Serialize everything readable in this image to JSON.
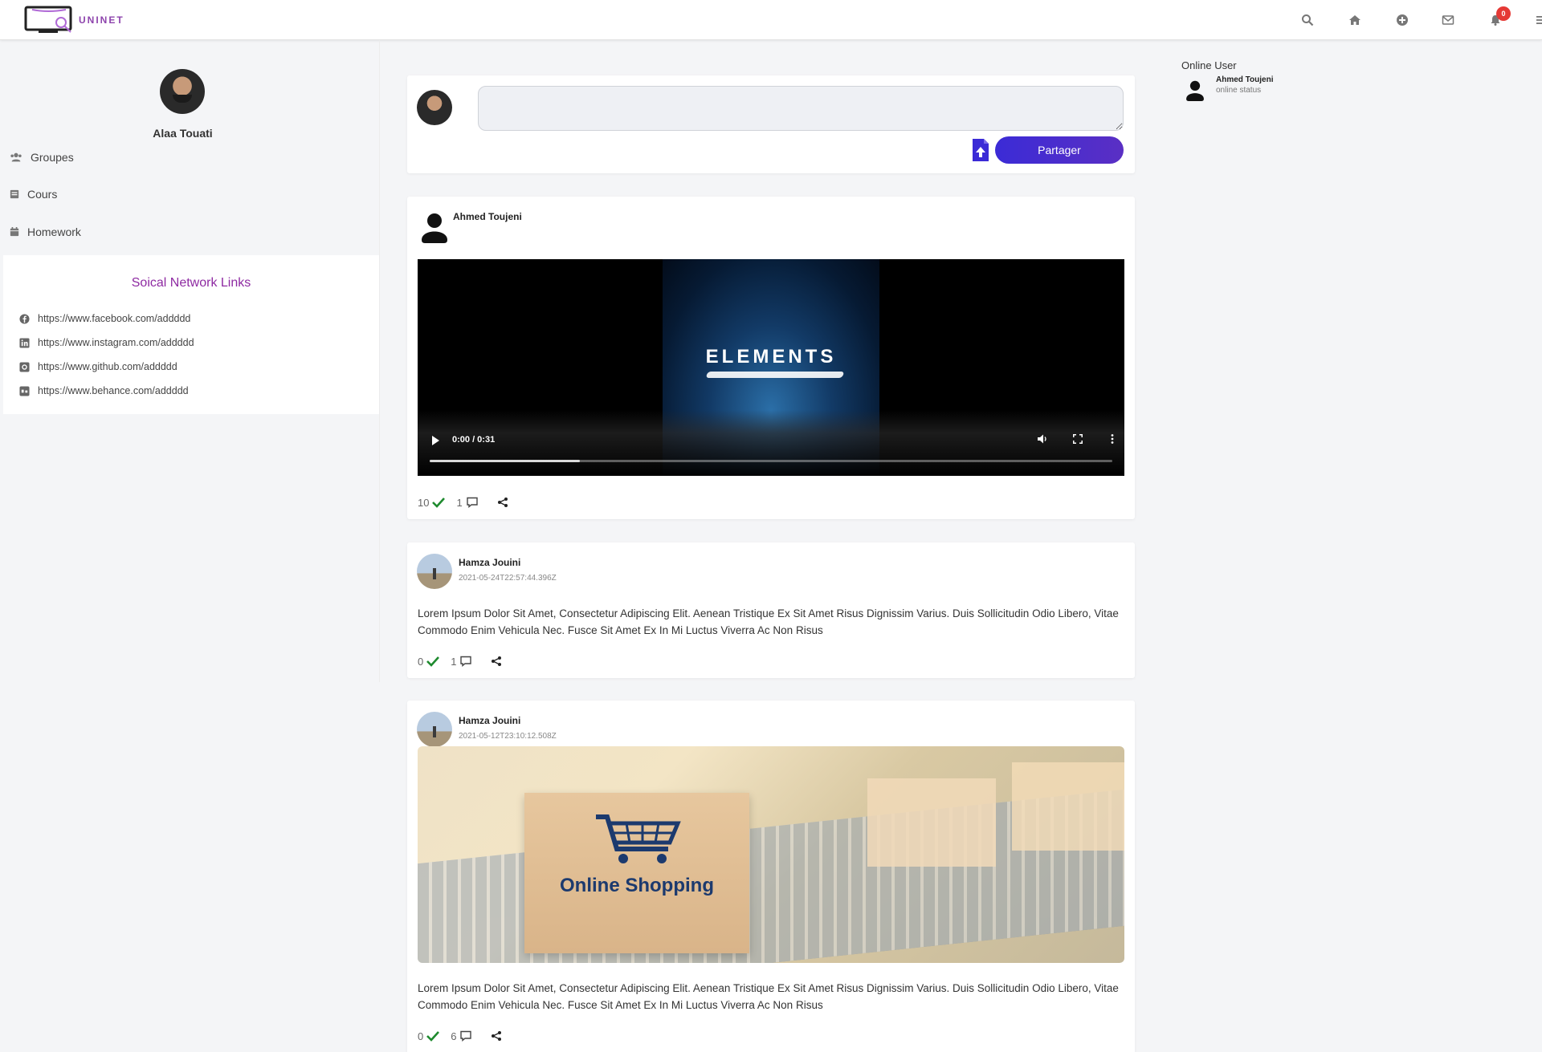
{
  "app": {
    "logo_text": "UNINET",
    "brand_color": "#8e44ad",
    "accent_color": "#4b2fd0"
  },
  "nav": {
    "icons": [
      "search-icon",
      "home-icon",
      "add-circle-icon",
      "mail-icon",
      "bell-icon",
      "menu-icon"
    ],
    "notification_count": "0"
  },
  "sidebar": {
    "profile_name": "Alaa Touati",
    "menu": [
      {
        "label": "Groupes",
        "icon": "users-icon"
      },
      {
        "label": "Cours",
        "icon": "book-icon"
      },
      {
        "label": "Homework",
        "icon": "calendar-icon"
      }
    ],
    "links_title": "Soical Network Links",
    "links": [
      {
        "url": "https://www.facebook.com/addddd",
        "icon": "facebook-icon"
      },
      {
        "url": "https://www.instagram.com/addddd",
        "icon": "linkedin-icon"
      },
      {
        "url": "https://www.github.com/addddd",
        "icon": "github-icon"
      },
      {
        "url": "https://www.behance.com/addddd",
        "icon": "behance-icon"
      }
    ]
  },
  "composer": {
    "placeholder": "",
    "share_label": "Partager"
  },
  "posts": [
    {
      "author": "Ahmed Toujeni",
      "video_title": "ELEMENTS",
      "video_time": "0:00 / 0:31",
      "video_progress": 0.22,
      "likes": "10",
      "comments": "1"
    },
    {
      "author": "Hamza Jouini",
      "date": "2021-05-24T22:57:44.396Z",
      "text": "Lorem Ipsum Dolor Sit Amet, Consectetur Adipiscing Elit. Aenean Tristique Ex Sit Amet Risus Dignissim Varius. Duis Sollicitudin Odio Libero, Vitae Commodo Enim Vehicula Nec. Fusce Sit Amet Ex In Mi Luctus Viverra Ac Non Risus",
      "likes": "0",
      "comments": "1"
    },
    {
      "author": "Hamza Jouini",
      "date": "2021-05-12T23:10:12.508Z",
      "image_label": "Online Shopping",
      "text": "Lorem Ipsum Dolor Sit Amet, Consectetur Adipiscing Elit. Aenean Tristique Ex Sit Amet Risus Dignissim Varius. Duis Sollicitudin Odio Libero, Vitae Commodo Enim Vehicula Nec. Fusce Sit Amet Ex In Mi Luctus Viverra Ac Non Risus",
      "likes": "0",
      "comments": "6"
    }
  ],
  "online": {
    "title": "Online User",
    "users": [
      {
        "name": "Ahmed Toujeni",
        "status": "online status"
      }
    ]
  }
}
